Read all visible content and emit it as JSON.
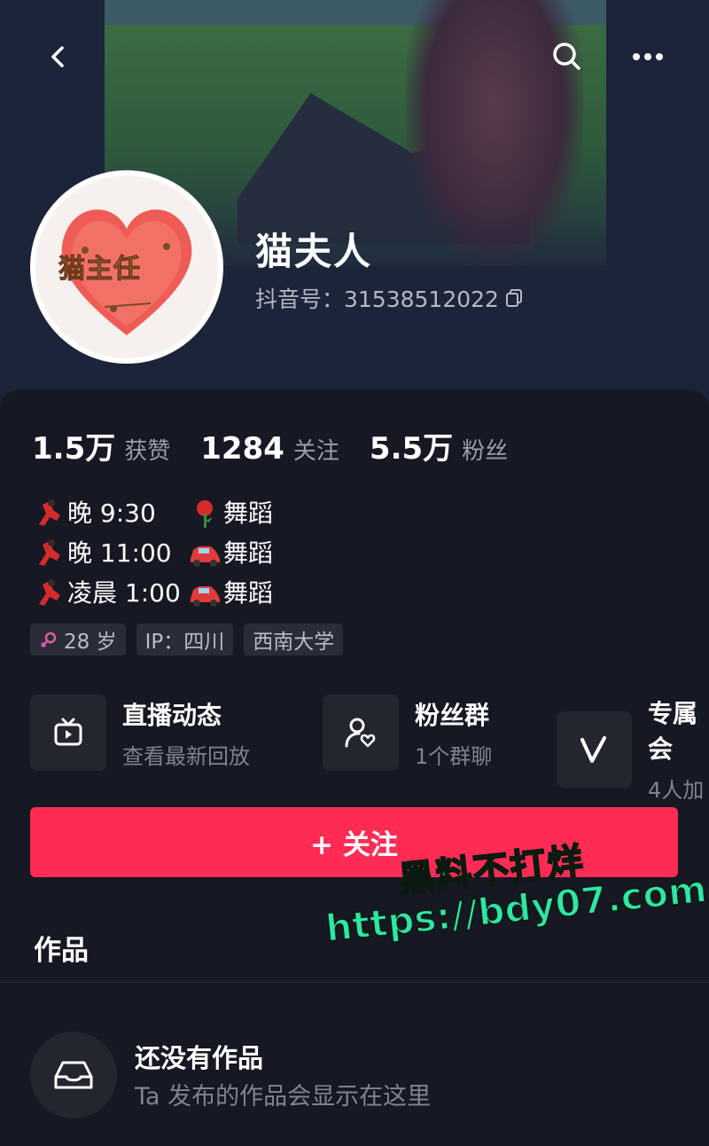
{
  "profile": {
    "nickname": "猫夫人",
    "douyin_id": "抖音号：31538512022",
    "avatar_text": "猫主任"
  },
  "stats": [
    {
      "value": "1.5万",
      "label": "获赞"
    },
    {
      "value": "1284",
      "label": "关注"
    },
    {
      "value": "5.5万",
      "label": "粉丝"
    }
  ],
  "bio": [
    {
      "time": "晚 9:30",
      "activity": "舞蹈",
      "emoji": "rose"
    },
    {
      "time": "晚 11:00",
      "activity": "舞蹈",
      "emoji": "car"
    },
    {
      "time": "凌晨 1:00",
      "activity": "舞蹈",
      "emoji": "car"
    }
  ],
  "tags": {
    "age": "28 岁",
    "ip": "IP：四川",
    "school": "西南大学"
  },
  "features": [
    {
      "title": "直播动态",
      "subtitle": "查看最新回放",
      "icon": "tv-icon"
    },
    {
      "title": "粉丝群",
      "subtitle": "1个群聊",
      "icon": "fan-group-icon"
    },
    {
      "title": "专属会",
      "subtitle": "4人加",
      "icon": "v-icon"
    }
  ],
  "follow_button": "+ 关注",
  "works": {
    "title": "作品",
    "empty_title": "还没有作品",
    "empty_subtitle": "Ta 发布的作品会显示在这里"
  },
  "watermark": {
    "line1": "黑料不打烊",
    "line2": "https://bdy07.com"
  },
  "colors": {
    "accent": "#fe2c55",
    "background": "#161823",
    "watermark": "#2ee6a6"
  }
}
